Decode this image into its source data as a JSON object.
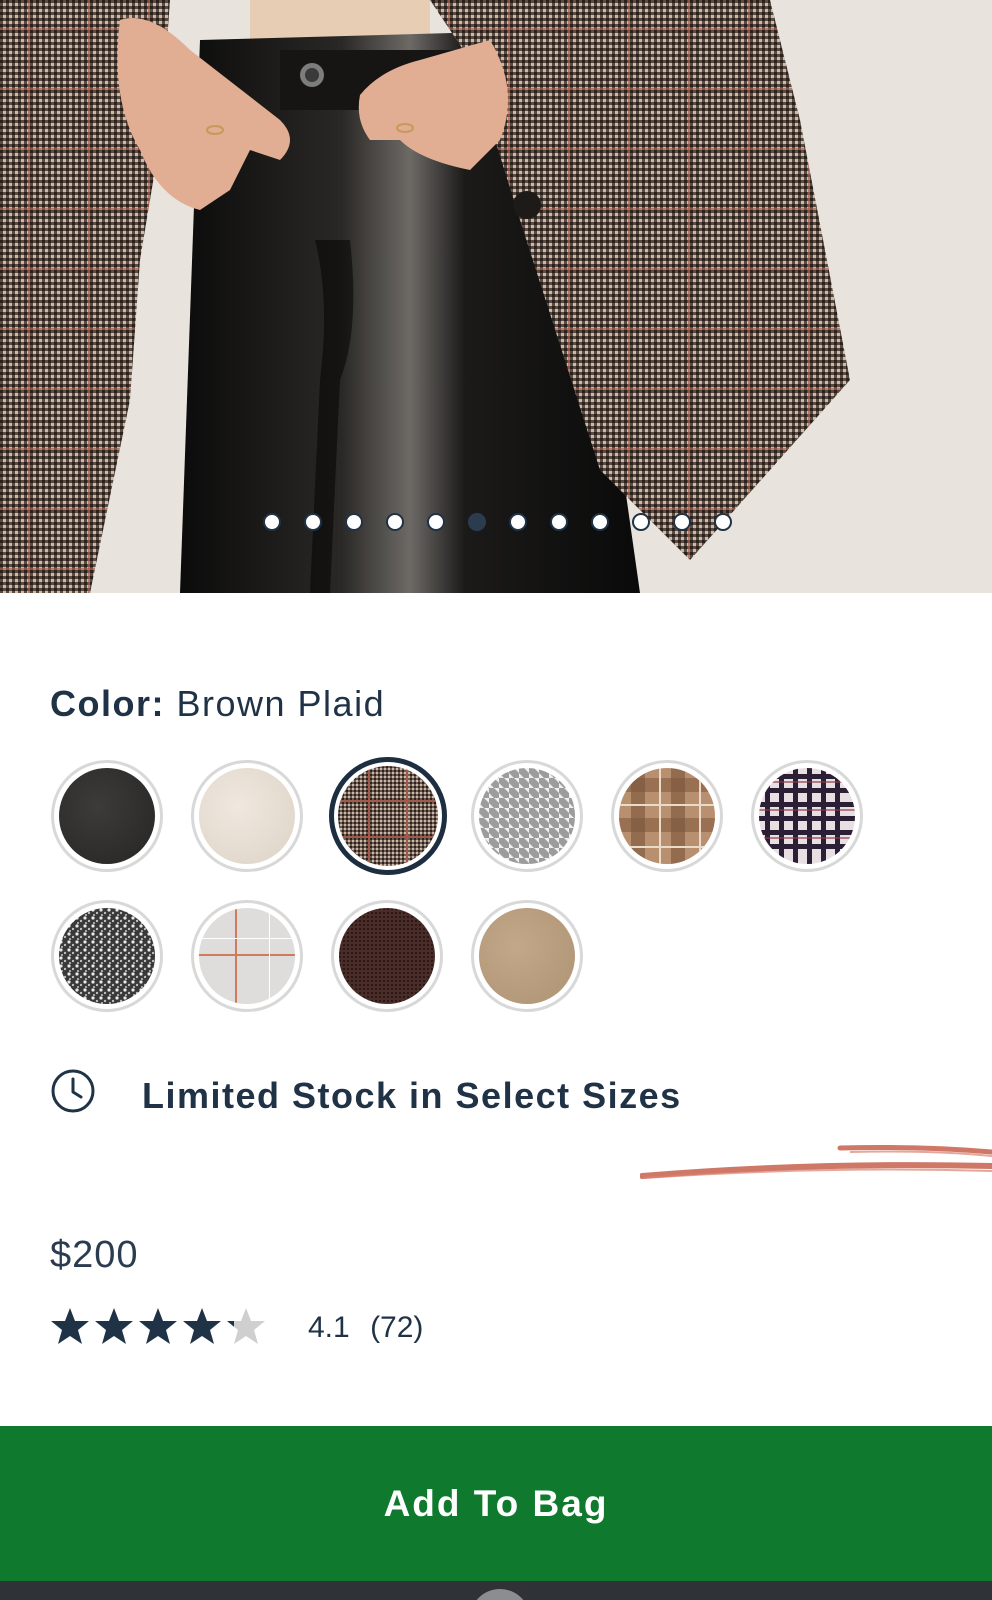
{
  "product_image": {
    "alt_icon": "product-photo",
    "carousel": {
      "total": 12,
      "active": 6
    }
  },
  "color": {
    "label": "Color:",
    "selected_name": "Brown Plaid",
    "swatches": [
      {
        "icon": "black-solid"
      },
      {
        "icon": "cream-solid"
      },
      {
        "icon": "brown-plaid",
        "selected": true
      },
      {
        "icon": "grey-houndstooth"
      },
      {
        "icon": "tan-plaid"
      },
      {
        "icon": "navy-check"
      },
      {
        "icon": "black-white-tweed"
      },
      {
        "icon": "light-grey-windowpane"
      },
      {
        "icon": "dark-brown-check"
      },
      {
        "icon": "camel-solid"
      }
    ]
  },
  "stock": {
    "icon": "clock-icon",
    "message": "Limited Stock in Select Sizes"
  },
  "price": "$200",
  "rating": {
    "value": "4.1",
    "count": "(72)",
    "stars": 4.1,
    "max": 5
  },
  "cta": {
    "label": "Add To Bag",
    "color": "#0f7a2e"
  },
  "colors": {
    "text": "#1f3246",
    "accent": "#0f7a2e",
    "underline": "#c8604e"
  }
}
